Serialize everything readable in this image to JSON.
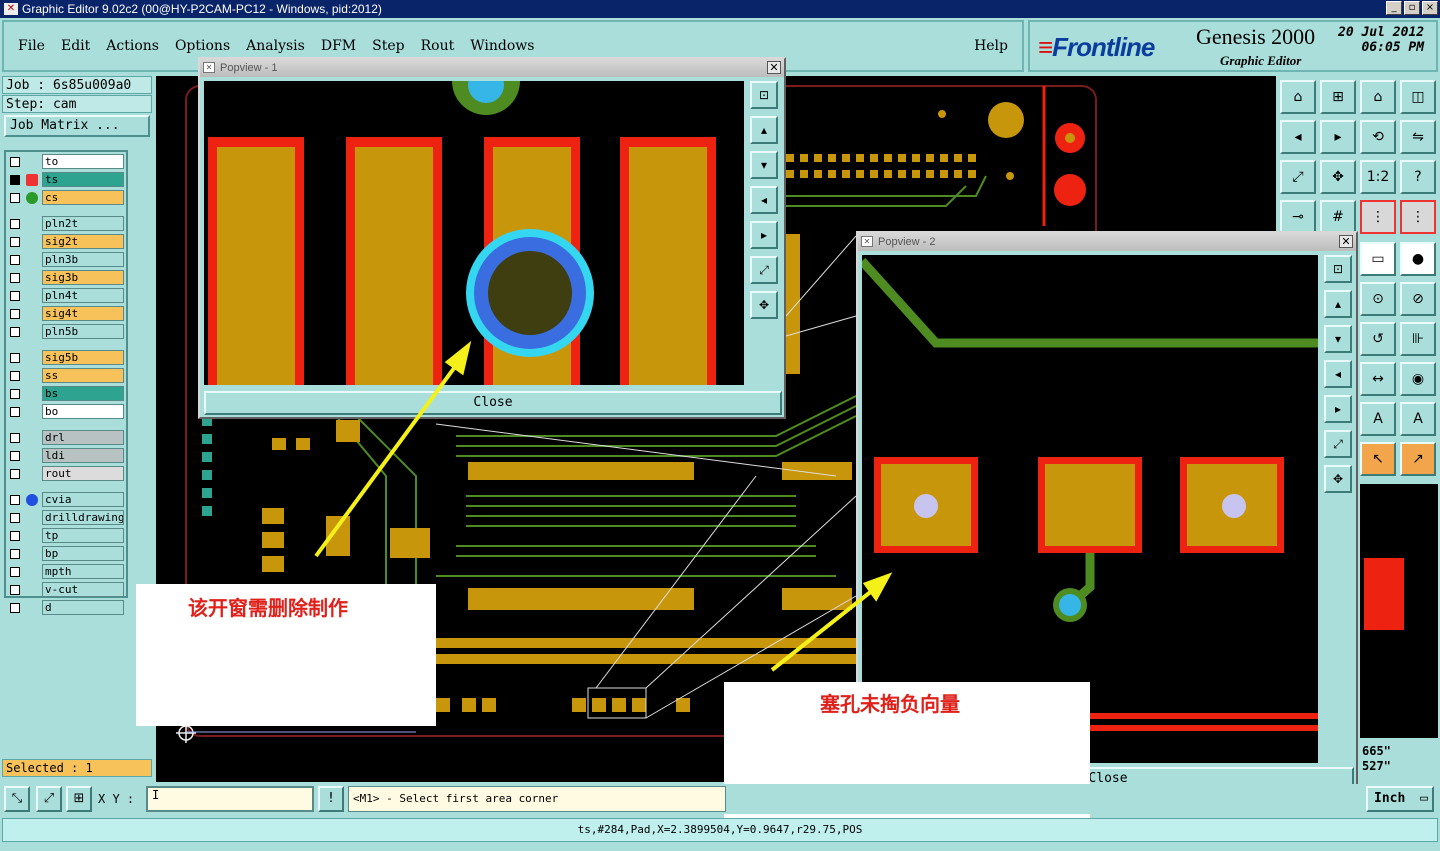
{
  "window": {
    "title": "Graphic Editor 9.02c2 (00@HY-P2CAM-PC12 - Windows, pid:2012)",
    "min": "_",
    "max": "▫",
    "close": "×"
  },
  "menu": {
    "file": "File",
    "edit": "Edit",
    "actions": "Actions",
    "options": "Options",
    "analysis": "Analysis",
    "dfm": "DFM",
    "step": "Step",
    "rout": "Rout",
    "windows": "Windows",
    "help": "Help"
  },
  "brand": {
    "logo": "Frontline",
    "product": "Genesis 2000",
    "subtitle": "Graphic Editor",
    "date": "20 Jul 2012",
    "time": "06:05 PM"
  },
  "job": {
    "job": "Job : 6s85u009a0",
    "step": "Step: cam",
    "matrix_button": "Job Matrix ..."
  },
  "layers": [
    {
      "name": "to",
      "color": "#ffffff"
    },
    {
      "name": "ts",
      "color": "#2ea38f"
    },
    {
      "name": "cs",
      "color": "#f7c25a"
    },
    {
      "name": "pln2t",
      "color": "#a9dedb"
    },
    {
      "name": "sig2t",
      "color": "#f7c25a"
    },
    {
      "name": "pln3b",
      "color": "#a9dedb"
    },
    {
      "name": "sig3b",
      "color": "#f7c25a"
    },
    {
      "name": "pln4t",
      "color": "#a9dedb"
    },
    {
      "name": "sig4t",
      "color": "#f7c25a"
    },
    {
      "name": "pln5b",
      "color": "#a9dedb"
    },
    {
      "name": "sig5b",
      "color": "#f7c25a"
    },
    {
      "name": "ss",
      "color": "#f7c25a"
    },
    {
      "name": "bs",
      "color": "#2ea38f"
    },
    {
      "name": "bo",
      "color": "#ffffff"
    },
    {
      "name": "drl",
      "color": "#b8c2c2"
    },
    {
      "name": "ldi",
      "color": "#b8c2c2"
    },
    {
      "name": "rout",
      "color": "#dcdcdc"
    },
    {
      "name": "cvia",
      "color": "#a9dedb"
    },
    {
      "name": "drilldrawing",
      "color": "#a9dedb"
    },
    {
      "name": "tp",
      "color": "#a9dedb"
    },
    {
      "name": "bp",
      "color": "#a9dedb"
    },
    {
      "name": "mpth",
      "color": "#a9dedb"
    },
    {
      "name": "v-cut",
      "color": "#a9dedb"
    },
    {
      "name": "d",
      "color": "#a9dedb"
    }
  ],
  "selected": "Selected : 1",
  "popview1": {
    "title": "Popview - 1",
    "close": "Close"
  },
  "popview2": {
    "title": "Popview - 2",
    "close": "Close"
  },
  "annotations": {
    "note1": "该开窗需删除制作",
    "note2": "塞孔未掏负向量"
  },
  "bottom": {
    "xy_label": "X Y :",
    "xy_value": "I",
    "excl": "!",
    "prompt": "<M1> - Select first area corner",
    "unit": "Inch"
  },
  "readout": {
    "x": "665\"",
    "y": "527\""
  },
  "status": "ts,#284,Pad,X=2.3899504,Y=0.9647,r29.75,POS",
  "right_tools": {
    "ratio": "1:2",
    "help": "?"
  }
}
